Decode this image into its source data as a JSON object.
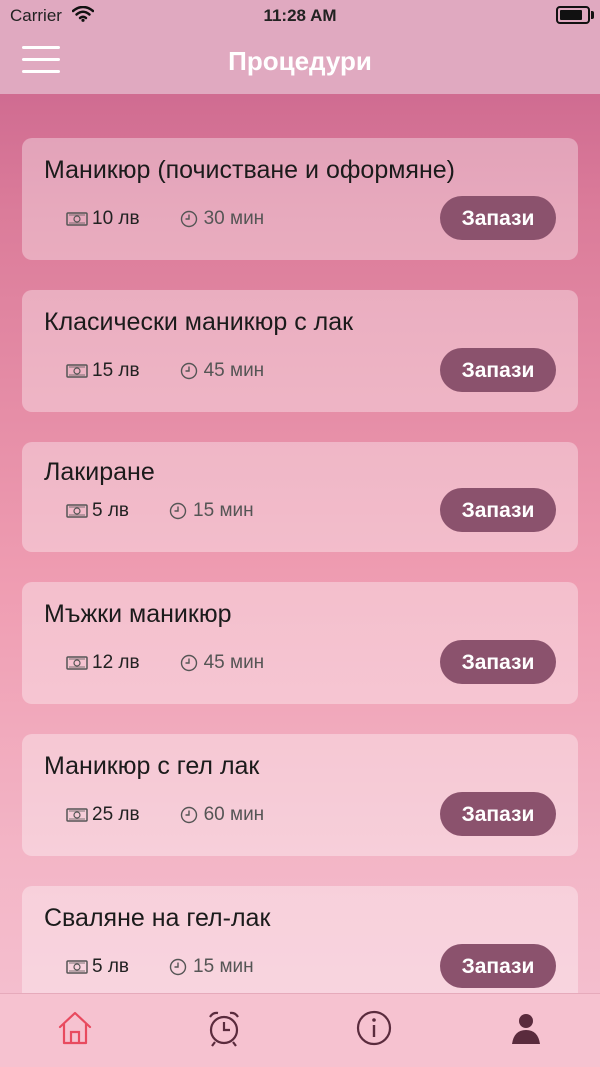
{
  "status_bar": {
    "carrier": "Carrier",
    "time": "11:28 AM",
    "wifi_icon": "wifi-icon",
    "battery_icon": "battery-icon"
  },
  "nav": {
    "title": "Процедури",
    "menu_icon": "hamburger-menu-icon"
  },
  "colors": {
    "accent": "#8b526d",
    "tab_active": "#e84a5f",
    "tab_inactive": "#5a2b3d"
  },
  "procedures": [
    {
      "title": "Маникюр (почистване и оформяне)",
      "price": "10 лв",
      "duration": "30 мин",
      "button": "Запази"
    },
    {
      "title": "Класически маникюр с лак",
      "price": "15 лв",
      "duration": "45 мин",
      "button": "Запази"
    },
    {
      "title": "Лакиране",
      "price": "5 лв",
      "duration": "15 мин",
      "button": "Запази"
    },
    {
      "title": "Мъжки маникюр",
      "price": "12 лв",
      "duration": "45 мин",
      "button": "Запази"
    },
    {
      "title": "Маникюр с гел лак",
      "price": "25 лв",
      "duration": "60 мин",
      "button": "Запази"
    },
    {
      "title": "Сваляне на гел-лак",
      "price": "5 лв",
      "duration": "15 мин",
      "button": "Запази"
    }
  ],
  "tabs": [
    {
      "icon": "home-icon",
      "active": true
    },
    {
      "icon": "alarm-clock-icon",
      "active": false
    },
    {
      "icon": "info-icon",
      "active": false
    },
    {
      "icon": "profile-icon",
      "active": false
    }
  ]
}
